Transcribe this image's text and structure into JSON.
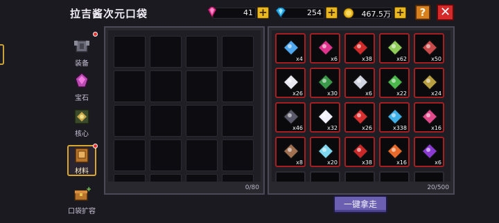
{
  "header": {
    "title": "拉吉酱次元口袋",
    "currencies": [
      {
        "icon": "pink-gem-icon",
        "value": "41",
        "color": "#e0338d"
      },
      {
        "icon": "blue-diamond-icon",
        "value": "254",
        "color": "#27a9e8"
      },
      {
        "icon": "gold-coin-icon",
        "value": "467.5万",
        "color": "#e8b81e"
      }
    ],
    "help_label": "?",
    "close_label": "✕"
  },
  "side_tabs": [
    {
      "label": "装备",
      "icon": "armor-icon",
      "badge": true,
      "active": false
    },
    {
      "label": "宝石",
      "icon": "gem-icon",
      "badge": false,
      "active": false
    },
    {
      "label": "核心",
      "icon": "core-icon",
      "badge": false,
      "active": false
    },
    {
      "label": "材料",
      "icon": "material-book-icon",
      "badge": true,
      "active": true
    },
    {
      "label": "口袋扩容",
      "icon": "chest-expand-icon",
      "badge": false,
      "active": false
    }
  ],
  "pocket": {
    "count": "0/80"
  },
  "inventory": {
    "count": "20/500",
    "items": [
      {
        "icon": "crystal-blade-icon",
        "qty": "x4",
        "color": "#4fa8f0"
      },
      {
        "icon": "red-crystal-icon",
        "qty": "x6",
        "color": "#e0338d"
      },
      {
        "icon": "dragon-egg-icon",
        "qty": "x38",
        "color": "#d02a2a"
      },
      {
        "icon": "gem-core-icon",
        "qty": "x62",
        "color": "#8fcc5a"
      },
      {
        "icon": "rune-stone-icon",
        "qty": "x50",
        "color": "#c84a4a"
      },
      {
        "icon": "bone-shard-icon",
        "qty": "x26",
        "color": "#e8e8f0"
      },
      {
        "icon": "green-dagger-icon",
        "qty": "x30",
        "color": "#3a9a4a"
      },
      {
        "icon": "steel-blade-icon",
        "qty": "x6",
        "color": "#d0d4e0"
      },
      {
        "icon": "vine-icon",
        "qty": "x22",
        "color": "#4ab84a"
      },
      {
        "icon": "herb-bundle-icon",
        "qty": "x24",
        "color": "#b8a040"
      },
      {
        "icon": "dark-helm-icon",
        "qty": "x46",
        "color": "#5a5a6a"
      },
      {
        "icon": "pearl-icon",
        "qty": "x32",
        "color": "#f0f0ff"
      },
      {
        "icon": "red-key-icon",
        "qty": "x26",
        "color": "#d83030"
      },
      {
        "icon": "blue-orb-icon",
        "qty": "x338",
        "color": "#3fb0e8"
      },
      {
        "icon": "pink-wand-icon",
        "qty": "x16",
        "color": "#e04a8a"
      },
      {
        "icon": "rusty-sword-icon",
        "qty": "x8",
        "color": "#a07050"
      },
      {
        "icon": "ice-shard-icon",
        "qty": "x20",
        "color": "#7fd8f0"
      },
      {
        "icon": "red-hood-icon",
        "qty": "x38",
        "color": "#c82828"
      },
      {
        "icon": "fire-feather-icon",
        "qty": "x16",
        "color": "#e86a2a"
      },
      {
        "icon": "void-orb-icon",
        "qty": "x6",
        "color": "#8a3ad0"
      }
    ]
  },
  "take_all_label": "一键拿走"
}
